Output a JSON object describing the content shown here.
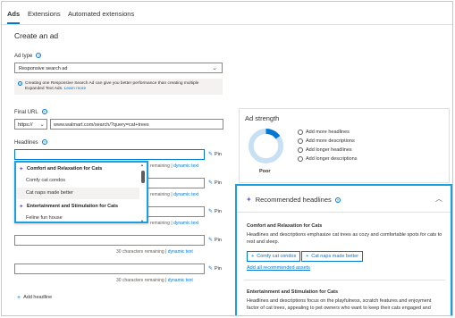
{
  "tabs": [
    {
      "label": "Ads",
      "active": true
    },
    {
      "label": "Extensions",
      "active": false
    },
    {
      "label": "Automated extensions",
      "active": false
    }
  ],
  "page_title": "Create an ad",
  "ad_type": {
    "label": "Ad type",
    "value": "Responsive search ad",
    "info_text": "Creating one Responsive Search Ad can give you better performance than creating multiple Expanded Text Ads.",
    "info_link": "Learn more"
  },
  "final_url": {
    "label": "Final URL",
    "protocol": "https://",
    "value": "www.walmart.com/search/?query=cat+trees"
  },
  "headlines": {
    "label": "Headlines",
    "pin_label": "Pin",
    "remaining_text": "30 characters remaining",
    "remaining_short": "remaining",
    "sep": "|",
    "dynamic_text": "dynamic text",
    "add_label": "Add headline"
  },
  "dropdown": {
    "groups": [
      {
        "title": "Comfort and Relaxation for Cats",
        "items": [
          "Comfy cat condos",
          "Cat naps made better"
        ]
      },
      {
        "title": "Entertainment and Stimulation for Cats",
        "items": [
          "Feline fun house"
        ]
      }
    ]
  },
  "ad_strength": {
    "title": "Ad strength",
    "rating": "Poor",
    "level": 0.15,
    "suggestions": [
      "Add more headlines",
      "Add more descriptions",
      "Add longer headlines",
      "Add longer descriptions"
    ]
  },
  "recommended": {
    "title": "Recommended headlines",
    "sections": [
      {
        "title": "Comfort and Relaxation for Cats",
        "desc_lines": [
          "Headlines and descriptions emphasize cat trees as cozy and comfortable spots for cats to",
          "rest and sleep."
        ],
        "chips": [
          "Comfy cat condos",
          "Cat naps made better"
        ],
        "link": "Add all recommended assets"
      },
      {
        "title": "Entertainment and Stimulation for Cats",
        "desc_lines": [
          "Headlines and descriptions focus on the playfulness, scratch features and enjoyment",
          "factor of cat trees, appealing to pet owners who want to keep their cats engaged and"
        ]
      }
    ]
  },
  "colors": {
    "accent": "#0078d4",
    "highlight": "#1a9fdf",
    "spark": "#7b5ec9"
  }
}
